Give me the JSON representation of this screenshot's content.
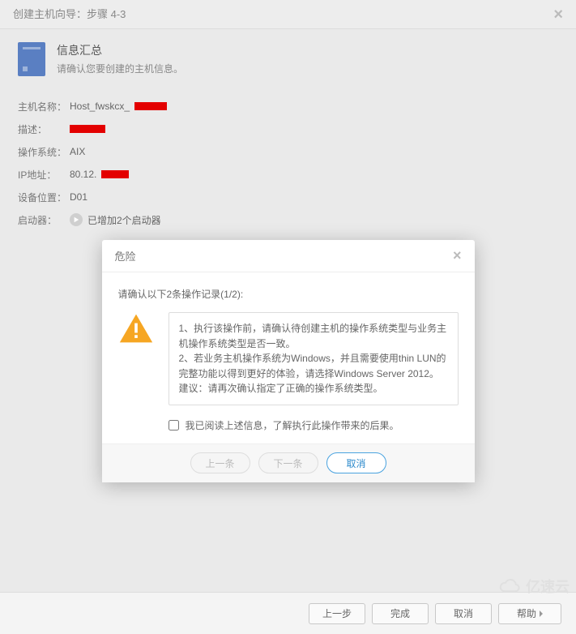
{
  "wizard": {
    "title": "创建主机向导：步骤 4-3",
    "close_label": "×"
  },
  "summary": {
    "heading": "信息汇总",
    "subtitle": "请确认您要创建的主机信息。"
  },
  "form": {
    "hostname_label": "主机名称：",
    "hostname_value": "Host_fwskcx_",
    "desc_label": "描述：",
    "os_label": "操作系统：",
    "os_value": "AIX",
    "ip_label": "IP地址：",
    "ip_value": "80.12.",
    "loc_label": "设备位置：",
    "loc_value": "D01",
    "initiator_label": "启动器：",
    "initiator_value": "已增加2个启动器"
  },
  "modal": {
    "title": "危险",
    "close_label": "×",
    "confirm_text": "请确认以下2条操作记录(1/2):",
    "body_line1": "1、执行该操作前，请确认待创建主机的操作系统类型与业务主机操作系统类型是否一致。",
    "body_line2": "2、若业务主机操作系统为Windows，并且需要使用thin LUN的完整功能以得到更好的体验，请选择Windows Server 2012。",
    "body_line3": "建议：请再次确认指定了正确的操作系统类型。",
    "ack_label": "我已阅读上述信息，了解执行此操作带来的后果。",
    "prev_label": "上一条",
    "next_label": "下一条",
    "cancel_label": "取消"
  },
  "footer": {
    "prev": "上一步",
    "finish": "完成",
    "cancel": "取消",
    "help": "帮助"
  },
  "watermark": "亿速云"
}
